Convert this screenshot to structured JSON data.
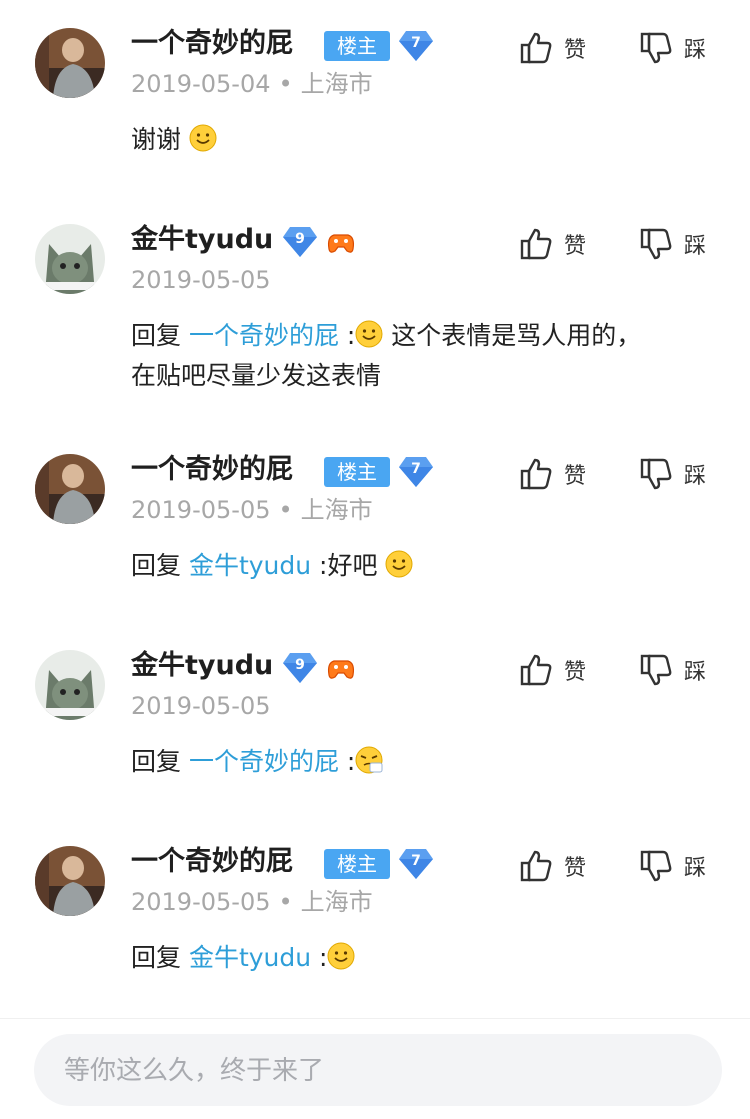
{
  "comments": [
    {
      "username": "一个奇妙的屁",
      "badge": "楼主",
      "level": "7",
      "date": "2019-05-04",
      "location": "上海市",
      "reply_prefix": "",
      "reply_to": "",
      "separator": "",
      "text": "谢谢",
      "emoji": "smile",
      "like_label": "赞",
      "dislike_label": "踩"
    },
    {
      "username": "金牛tyudu",
      "level": "9",
      "date": "2019-05-05",
      "reply_prefix": "回复 ",
      "reply_to": "一个奇妙的屁",
      "separator": " :",
      "emoji": "smile",
      "text": " 这个表情是骂人用的，在贴吧尽量少发这表情",
      "like_label": "赞",
      "dislike_label": "踩"
    },
    {
      "username": "一个奇妙的屁",
      "badge": "楼主",
      "level": "7",
      "date": "2019-05-05",
      "location": "上海市",
      "reply_prefix": "回复 ",
      "reply_to": "金牛tyudu",
      "separator": " :",
      "text": "好吧",
      "emoji": "smile",
      "like_label": "赞",
      "dislike_label": "踩"
    },
    {
      "username": "金牛tyudu",
      "level": "9",
      "date": "2019-05-05",
      "reply_prefix": "回复 ",
      "reply_to": "一个奇妙的屁",
      "separator": " :",
      "emoji": "sneeze",
      "like_label": "赞",
      "dislike_label": "踩"
    },
    {
      "username": "一个奇妙的屁",
      "badge": "楼主",
      "level": "7",
      "date": "2019-05-05",
      "location": "上海市",
      "reply_prefix": "回复 ",
      "reply_to": "金牛tyudu",
      "separator": " :",
      "emoji": "smile",
      "like_label": "赞",
      "dislike_label": "踩"
    }
  ],
  "input": {
    "placeholder": "等你这么久，终于来了"
  },
  "colors": {
    "reply_link": "#2e9ed8",
    "badge_bg": "#4aa6f2",
    "level_badge": "#5b9ff0",
    "meta_text": "#a7a7a7"
  },
  "icons": {
    "like": "thumbs-up-icon",
    "dislike": "thumbs-down-icon",
    "level": "diamond-level-icon",
    "game": "game-controller-icon"
  }
}
